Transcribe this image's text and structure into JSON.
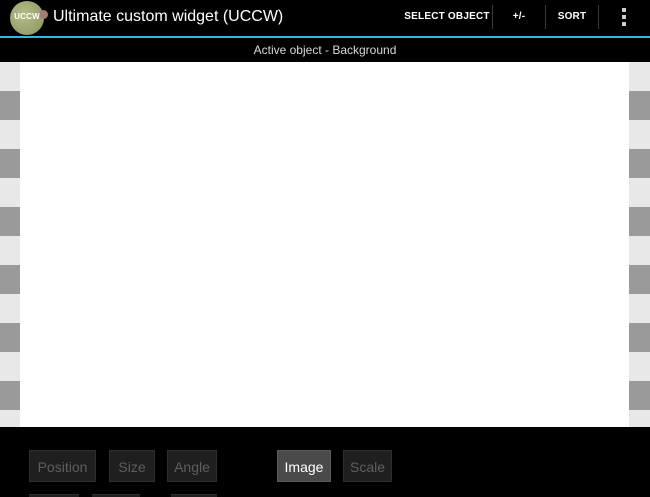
{
  "app": {
    "icon_text": "UCCW",
    "title": "Ultimate custom widget (UCCW)"
  },
  "actions": {
    "select_object": "SELECT OBJECT",
    "plus_minus": "+/-",
    "sort": "SORT"
  },
  "status": {
    "text": "Active object - Background"
  },
  "controls": {
    "position": "Position",
    "size": "Size",
    "angle": "Angle",
    "image": "Image",
    "scale": "Scale",
    "active": "Image"
  },
  "colors": {
    "accent": "#33b5e5",
    "canvas": "#ffffff",
    "background": "#000000"
  }
}
